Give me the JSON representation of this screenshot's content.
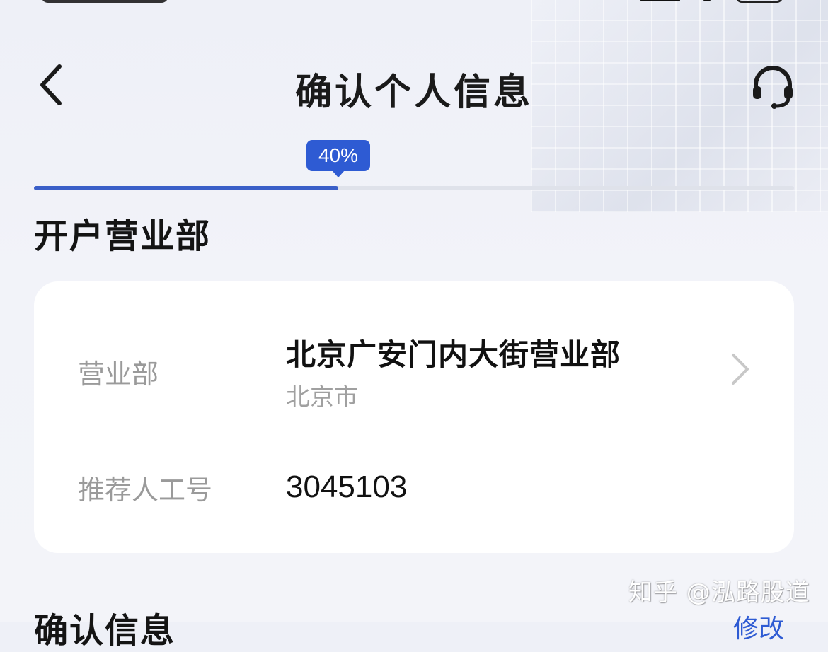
{
  "nav": {
    "title": "确认个人信息",
    "back_icon": "chevron-left-icon",
    "service_icon": "headset-icon"
  },
  "progress": {
    "label": "40%",
    "fraction": 0.4,
    "color": "#2e5bd3"
  },
  "section_branch": {
    "title": "开户营业部"
  },
  "branch_card": {
    "branch_label": "营业部",
    "branch_name": "北京广安门内大街营业部",
    "branch_city": "北京市",
    "referrer_label": "推荐人工号",
    "referrer_value": "3045103"
  },
  "section_confirm": {
    "title": "确认信息",
    "edit_label": "修改"
  },
  "watermark": "知乎 @泓路股道"
}
